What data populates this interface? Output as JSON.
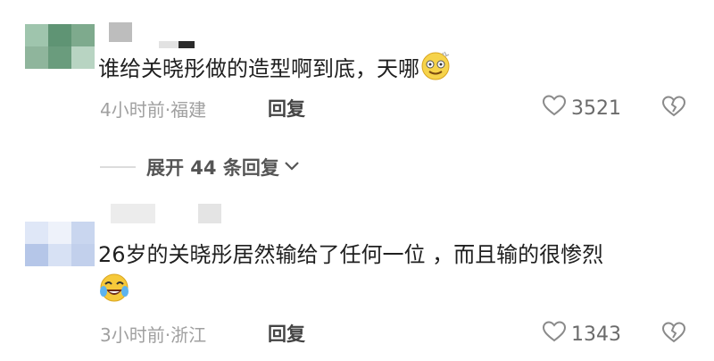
{
  "comments": [
    {
      "text": "谁给关晓彤做的造型啊到底，天哪",
      "time_location": "4小时前·福建",
      "reply_label": "回复",
      "likes": "3521"
    },
    {
      "text_line1": "26岁的关晓彤居然输给了任何一位  ，而且输的很惨烈",
      "time_location": "3小时前·浙江",
      "reply_label": "回复",
      "likes": "1343"
    }
  ],
  "expand_replies": {
    "label": "展开 44 条回复"
  },
  "icons": {
    "like": "heart-outline-icon",
    "dislike": "broken-heart-outline-icon",
    "expand": "chevron-down-icon",
    "emoji1": "dazed-smile-emoji",
    "emoji2": "laughing-crying-emoji"
  },
  "colors": {
    "meta": "#a0a0a0",
    "text": "#1f1f1f",
    "divider": "#dcdcdc"
  }
}
